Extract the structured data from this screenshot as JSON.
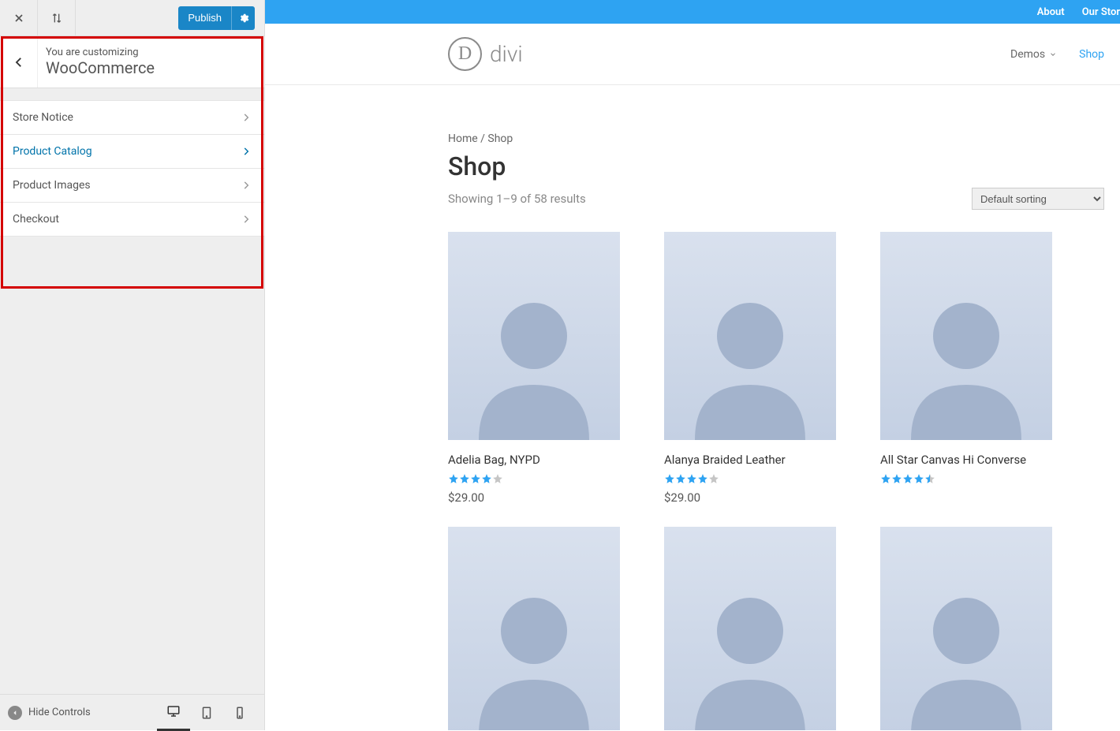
{
  "sidebar": {
    "publish_label": "Publish",
    "header_sub": "You are customizing",
    "header_title": "WooCommerce",
    "menu": [
      {
        "label": "Store Notice",
        "active": false
      },
      {
        "label": "Product Catalog",
        "active": true
      },
      {
        "label": "Product Images",
        "active": false
      },
      {
        "label": "Checkout",
        "active": false
      }
    ],
    "hide_controls": "Hide Controls"
  },
  "topbar": [
    "About",
    "Our Stor"
  ],
  "logo_text": "divi",
  "logo_letter": "D",
  "nav": [
    {
      "label": "Demos",
      "has_caret": true,
      "active": false
    },
    {
      "label": "Shop",
      "has_caret": false,
      "active": true
    }
  ],
  "breadcrumb": "Home / Shop",
  "page_title": "Shop",
  "result_count": "Showing 1–9 of 58 results",
  "sort": {
    "selected": "Default sorting",
    "options": [
      "Default sorting"
    ]
  },
  "products": [
    {
      "title": "Adelia Bag, NYPD",
      "rating": 4,
      "price": "$29.00"
    },
    {
      "title": "Alanya Braided Leather",
      "rating": 4,
      "price": "$29.00"
    },
    {
      "title": "All Star Canvas Hi Converse",
      "rating": 4.5,
      "price": ""
    },
    {
      "title": "",
      "rating": 0,
      "price": ""
    },
    {
      "title": "",
      "rating": 0,
      "price": ""
    },
    {
      "title": "",
      "rating": 0,
      "price": ""
    }
  ],
  "colors": {
    "accent": "#2ea3f2",
    "publish": "#1a86c7",
    "highlight": "#d40000"
  }
}
